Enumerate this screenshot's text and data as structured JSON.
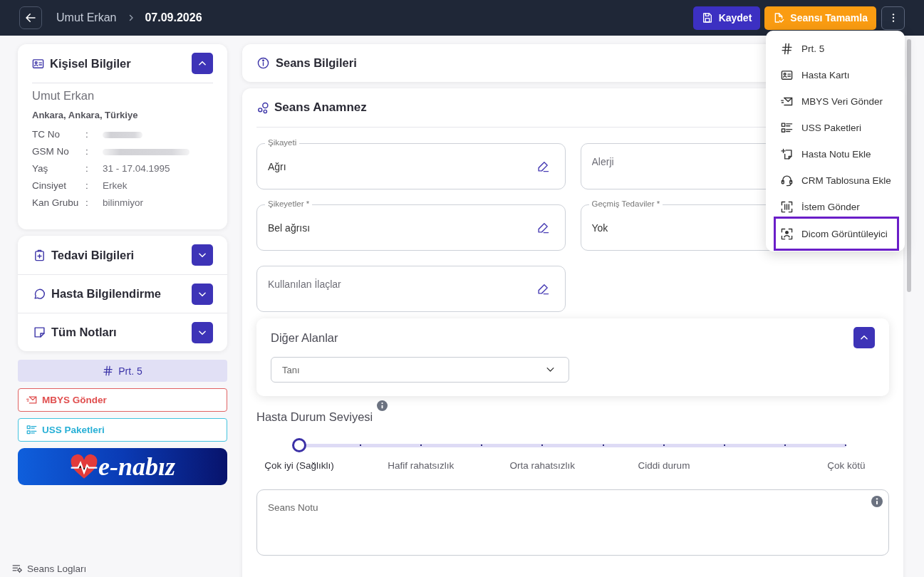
{
  "header": {
    "breadcrumb": [
      {
        "label": "Umut Erkan",
        "current": false
      },
      {
        "label": "07.09.2026",
        "current": true
      }
    ],
    "buttons": [
      {
        "label": "Kaydet",
        "kind": "save"
      },
      {
        "label": "Seansı Tamamla",
        "kind": "complete"
      }
    ]
  },
  "actions_menu": {
    "open": true,
    "items": [
      {
        "label": "Prt. 5",
        "selected": false
      },
      {
        "label": "Hasta Kartı",
        "selected": false
      },
      {
        "label": "MBYS Veri Gönder",
        "selected": false
      },
      {
        "label": "USS Paketleri",
        "selected": false
      },
      {
        "label": "Hasta Notu Ekle",
        "selected": false
      },
      {
        "label": "CRM Tablosuna Ekle",
        "selected": false
      },
      {
        "label": "İstem Gönder",
        "selected": false
      },
      {
        "label": "Dicom Görüntüleyici",
        "selected": true
      }
    ]
  },
  "personal_info": {
    "title": "Kişisel Bilgiler",
    "expanded": true,
    "name": "Umut Erkan",
    "address": "Ankara, Ankara, Türkiye",
    "fields": [
      {
        "label": "TC No",
        "separator": ":",
        "kind": "redacted"
      },
      {
        "label": "GSM No",
        "separator": ":",
        "kind": "redacted"
      },
      {
        "label": "Yaş",
        "separator": ":",
        "kind": "text",
        "value": "31 - 17.04.1995"
      },
      {
        "label": "Cinsiyet",
        "separator": ":",
        "kind": "text",
        "value": "Erkek"
      },
      {
        "label": "Kan Grubu",
        "separator": ":",
        "kind": "text",
        "value": "bilinmiyor"
      }
    ]
  },
  "sections": [
    {
      "title": "Tedavi Bilgileri",
      "expanded": false
    },
    {
      "title": "Hasta Bilgilendirme",
      "expanded": false
    },
    {
      "title": "Tüm Notları",
      "expanded": false
    }
  ],
  "quick_actions": [
    {
      "label": "Prt. 5",
      "kind": "protocol"
    },
    {
      "label": "MBYS Gönder",
      "kind": "mbys"
    },
    {
      "label": "USS Paketleri",
      "kind": "uss"
    }
  ],
  "banner": {
    "label": "e-nabız"
  },
  "footer": {
    "label": "Seans Logları"
  },
  "session_info": {
    "title": "Seans Bilgileri"
  },
  "anamnesis": {
    "title": "Seans Anamnez",
    "columns": [
      {
        "fields": [
          {
            "label": "Şikayeti",
            "value": "Ağrı",
            "editable": true
          },
          {
            "label": "Şikeyetler *",
            "value": "Bel ağrısı",
            "editable": true
          },
          {
            "placeholder": "Kullanılan İlaçlar",
            "editable": true
          }
        ]
      },
      {
        "fields": [
          {
            "placeholder": "Alerji"
          },
          {
            "label": "Geçmiş Tedaviler *",
            "value": "Yok"
          }
        ]
      }
    ]
  },
  "other_fields": {
    "title": "Diğer Alanlar",
    "expanded": true,
    "dropdown": {
      "placeholder": "Tanı"
    }
  },
  "severity": {
    "label": "Hasta Durum Seviyesi",
    "level": 0,
    "marks": [
      {
        "label": "Çok iyi (Sağlıklı)",
        "selected": true
      },
      {
        "label": "Hafif rahatsızlık",
        "selected": false
      },
      {
        "label": "Orta rahatsızlık",
        "selected": false
      },
      {
        "label": "Ciddi durum",
        "selected": false
      },
      {
        "label": "Çok kötü",
        "selected": false
      }
    ]
  },
  "session_note": {
    "placeholder": "Seans Notu"
  }
}
